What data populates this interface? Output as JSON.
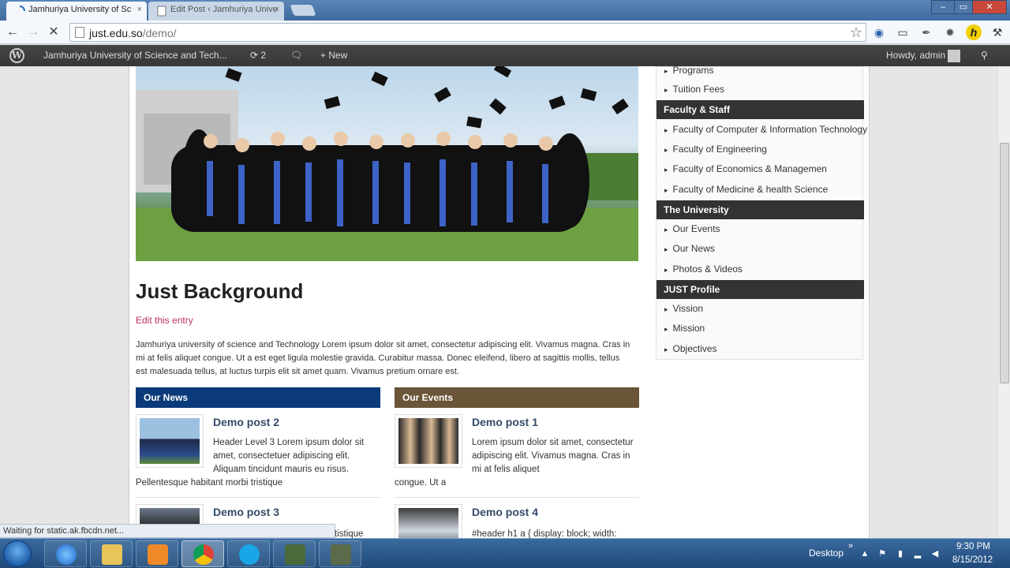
{
  "browser": {
    "tabs": [
      {
        "label": "Jamhuriya University of Sc",
        "active": true
      },
      {
        "label": "Edit Post ‹ Jamhuriya Unive",
        "active": false
      }
    ],
    "tab_close": "×",
    "url_host": "just.edu.so",
    "url_path": "/demo/",
    "window_controls": {
      "minimize": "–",
      "restore": "▭",
      "close": "✕"
    }
  },
  "adminbar": {
    "site_name": "Jamhuriya University of Science and Tech...",
    "updates_count": "2",
    "new_label": "New",
    "greeting": "Howdy, admin"
  },
  "post": {
    "title": "Just Background",
    "edit_link": "Edit this entry",
    "body": "Jamhuriya university of science and Technology Lorem ipsum dolor sit amet, consectetur adipiscing elit. Vivamus magna. Cras in mi at felis aliquet congue. Ut a est eget ligula molestie gravida. Curabitur massa. Donec eleifend, libero at sagittis mollis, tellus est malesuada tellus, at luctus turpis elit sit amet quam. Vivamus pretium ornare est."
  },
  "news": {
    "heading": "Our News",
    "heading_color": "#0a3a7a",
    "items": [
      {
        "title": "Demo post 2",
        "excerpt": "Header Level 3 Lorem ipsum dolor sit amet, consectetuer adipiscing elit. Aliquam tincidunt mauris eu risus.",
        "tail": "Pellentesque habitant morbi tristique"
      },
      {
        "title": "Demo post 3",
        "excerpt": "",
        "tail": "tistique"
      }
    ]
  },
  "events": {
    "heading": "Our Events",
    "heading_color": "#6b5538",
    "items": [
      {
        "title": "Demo post 1",
        "excerpt": " Lorem ipsum dolor sit amet, consectetur adipiscing elit. Vivamus magna. Cras in mi at felis aliquet",
        "tail": "congue. Ut a"
      },
      {
        "title": "Demo post 4",
        "excerpt": "#header h1 a { display: block; width:",
        "tail": ""
      }
    ]
  },
  "sidebar": {
    "top_items": [
      "Programs",
      "Tuition Fees"
    ],
    "sections": [
      {
        "heading": "Faculty & Staff",
        "items": [
          "Faculty of Computer & Information Technology",
          "Faculty of Engineering",
          "Faculty of Economics & Managemen",
          "Faculty of Medicine & health Science"
        ]
      },
      {
        "heading": "The University",
        "items": [
          "Our Events",
          "Our News",
          "Photos & Videos"
        ]
      },
      {
        "heading": "JUST Profile",
        "items": [
          "Vission",
          "Mission",
          "Objectives"
        ]
      }
    ]
  },
  "status_bar": "Waiting for static.ak.fbcdn.net...",
  "taskbar": {
    "desktop_label": "Desktop",
    "time": "9:30 PM",
    "date": "8/15/2012"
  },
  "colors": {
    "admin_bar": "#3d3d3d",
    "sidebar_heading": "#333333",
    "link_pink": "#c0306a"
  }
}
